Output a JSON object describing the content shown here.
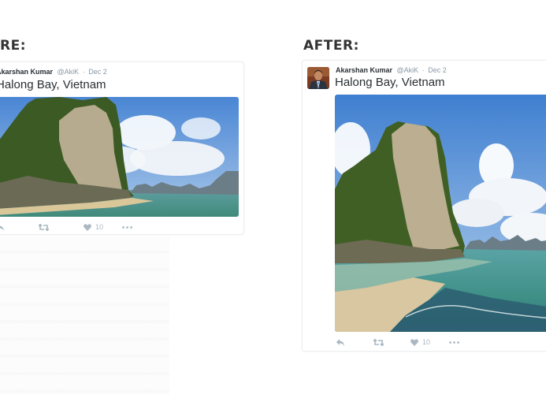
{
  "labels": {
    "before": "RE:",
    "after": "AFTER:"
  },
  "before_tweet": {
    "author_name": "Akarshan Kumar",
    "handle": "@AkiK",
    "separator": "·",
    "date": "Dec 2",
    "text": "Halong Bay, Vietnam",
    "like_count": "10",
    "actions": [
      "reply-icon",
      "retweet-icon",
      "heart-icon",
      "more-icon"
    ]
  },
  "after_tweet": {
    "author_name": "Akarshan Kumar",
    "handle": "@AkiK",
    "separator": "·",
    "date": "Dec 2",
    "text": "Halong Bay, Vietnam",
    "like_count": "10",
    "actions": [
      "reply-icon",
      "retweet-icon",
      "heart-icon",
      "more-icon"
    ]
  },
  "colors": {
    "icon_gray": "#aab8c2",
    "meta_gray": "#8899a6",
    "text": "#292f33"
  }
}
